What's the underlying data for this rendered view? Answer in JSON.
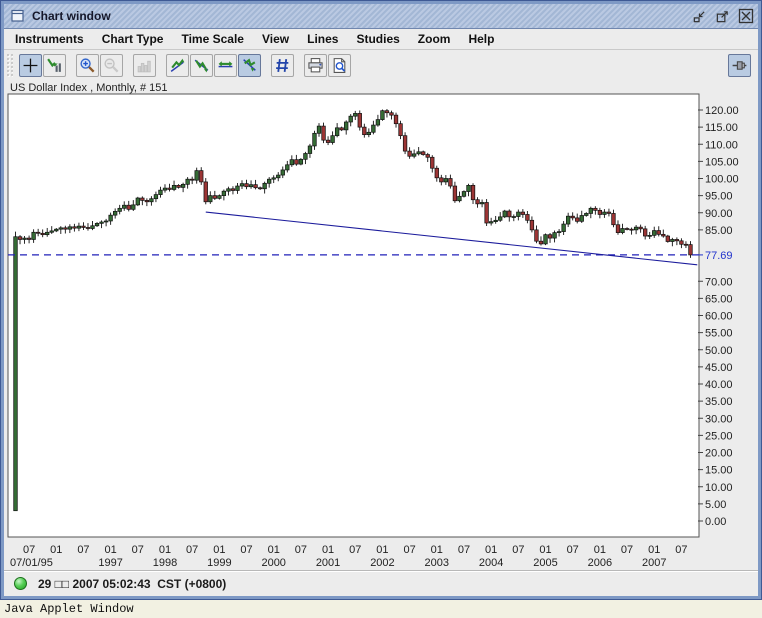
{
  "window": {
    "title": "Chart window",
    "controls": [
      "iconify",
      "maximize",
      "close"
    ]
  },
  "menu": {
    "items": [
      {
        "label": "Instruments"
      },
      {
        "label": "Chart Type"
      },
      {
        "label": "Time Scale"
      },
      {
        "label": "View"
      },
      {
        "label": "Lines"
      },
      {
        "label": "Studies"
      },
      {
        "label": "Zoom"
      },
      {
        "label": "Help"
      }
    ]
  },
  "toolbar": {
    "buttons": [
      {
        "name": "crosshair",
        "state": "selected"
      },
      {
        "name": "candle-data-tool",
        "state": "normal"
      },
      {
        "name": "zoom-in",
        "state": "normal"
      },
      {
        "name": "zoom-out",
        "state": "disabled"
      },
      {
        "name": "histogram",
        "state": "disabled"
      },
      {
        "name": "trendline-up",
        "state": "normal"
      },
      {
        "name": "trendline-down",
        "state": "normal"
      },
      {
        "name": "horizontal-line",
        "state": "normal"
      },
      {
        "name": "erase-line",
        "state": "selected"
      },
      {
        "name": "grid-hash",
        "state": "normal"
      },
      {
        "name": "print",
        "state": "normal"
      },
      {
        "name": "print-preview",
        "state": "normal"
      },
      {
        "name": "pin",
        "state": "selected"
      }
    ]
  },
  "chart_data": {
    "type": "candlestick",
    "title": "US Dollar Index , Monthly, # 151",
    "instrument_label": "US Dollar Index , Monthly, # 151",
    "start_month": "1995-04",
    "interval": "monthly",
    "current_price": 77.69,
    "current_price_label": "77.69",
    "level_line": {
      "price": 77.69,
      "style": "dashed",
      "color": "#2020b8"
    },
    "trendline": {
      "start_month_index": 42,
      "start_price": 90.2,
      "end_month_index": 150.5,
      "end_price": 74.8,
      "color": "#1c1c9c"
    },
    "first_bar": {
      "open": 3.0,
      "high": 84.5,
      "low": 3.0,
      "close": 83.0
    },
    "closes": [
      83.0,
      82.2,
      82.6,
      82.2,
      84.3,
      84.0,
      83.6,
      84.3,
      84.7,
      85.2,
      85.6,
      85.2,
      85.9,
      85.5,
      86.1,
      85.7,
      85.4,
      86.2,
      86.9,
      87.3,
      87.6,
      89.3,
      90.4,
      91.3,
      92.2,
      91.0,
      92.3,
      94.3,
      93.6,
      93.2,
      94.1,
      95.3,
      96.6,
      97.2,
      96.8,
      98.0,
      97.4,
      98.3,
      99.8,
      99.5,
      102.3,
      99.0,
      93.2,
      95.0,
      94.2,
      95.0,
      96.3,
      97.0,
      96.5,
      97.8,
      98.5,
      97.6,
      98.2,
      97.3,
      97.0,
      98.6,
      99.8,
      100.2,
      101.0,
      102.5,
      104.0,
      105.5,
      104.2,
      105.6,
      107.3,
      109.5,
      113.2,
      115.3,
      111.2,
      110.5,
      112.5,
      114.8,
      114.2,
      116.5,
      118.2,
      119.0,
      115.0,
      112.8,
      113.5,
      115.6,
      117.2,
      119.8,
      119.2,
      118.5,
      116.0,
      112.5,
      108.0,
      106.5,
      107.2,
      107.8,
      107.0,
      106.2,
      103.0,
      100.2,
      99.0,
      100.0,
      97.8,
      93.5,
      94.8,
      96.2,
      98.0,
      93.8,
      92.6,
      93.0,
      87.0,
      87.4,
      87.8,
      88.8,
      90.5,
      88.8,
      88.9,
      90.2,
      89.5,
      87.8,
      85.0,
      81.7,
      80.9,
      83.6,
      82.6,
      84.2,
      84.5,
      86.7,
      89.0,
      88.5,
      87.5,
      89.2,
      89.8,
      91.3,
      90.7,
      89.5,
      90.2,
      89.8,
      86.5,
      84.2,
      85.4,
      85.2,
      85.0,
      85.8,
      85.3,
      83.2,
      83.4,
      84.8,
      83.7,
      83.2,
      81.6,
      82.2,
      81.8,
      80.8,
      80.7,
      77.69
    ],
    "y_axis": {
      "min": 0,
      "max": 120,
      "step": 5,
      "ticks": [
        120,
        115,
        110,
        105,
        100,
        95,
        90,
        85,
        70,
        65,
        60,
        55,
        50,
        45,
        40,
        35,
        30,
        25,
        20,
        15,
        10,
        5,
        0
      ],
      "label_format": "0.00"
    },
    "x_axis": {
      "ticks": [
        {
          "m": 3,
          "label": "07",
          "sub": "07/01/95"
        },
        {
          "m": 9,
          "label": "01",
          "sub": ""
        },
        {
          "m": 15,
          "label": "07",
          "sub": ""
        },
        {
          "m": 21,
          "label": "01",
          "sub": "1997"
        },
        {
          "m": 27,
          "label": "07",
          "sub": ""
        },
        {
          "m": 33,
          "label": "01",
          "sub": "1998"
        },
        {
          "m": 39,
          "label": "07",
          "sub": ""
        },
        {
          "m": 45,
          "label": "01",
          "sub": "1999"
        },
        {
          "m": 51,
          "label": "07",
          "sub": ""
        },
        {
          "m": 57,
          "label": "01",
          "sub": "2000"
        },
        {
          "m": 63,
          "label": "07",
          "sub": ""
        },
        {
          "m": 69,
          "label": "01",
          "sub": "2001"
        },
        {
          "m": 75,
          "label": "07",
          "sub": ""
        },
        {
          "m": 81,
          "label": "01",
          "sub": "2002"
        },
        {
          "m": 87,
          "label": "07",
          "sub": ""
        },
        {
          "m": 93,
          "label": "01",
          "sub": "2003"
        },
        {
          "m": 99,
          "label": "07",
          "sub": ""
        },
        {
          "m": 105,
          "label": "01",
          "sub": "2004"
        },
        {
          "m": 111,
          "label": "07",
          "sub": ""
        },
        {
          "m": 117,
          "label": "01",
          "sub": "2005"
        },
        {
          "m": 123,
          "label": "07",
          "sub": ""
        },
        {
          "m": 129,
          "label": "01",
          "sub": "2006"
        },
        {
          "m": 135,
          "label": "07",
          "sub": ""
        },
        {
          "m": 141,
          "label": "01",
          "sub": "2007"
        },
        {
          "m": 147,
          "label": "07",
          "sub": ""
        }
      ]
    },
    "colors": {
      "up": "#356b35",
      "down": "#9c3535",
      "wick": "#101010",
      "axis_text": "#222222",
      "current_price_text": "#2233cc",
      "plot_border": "#555555",
      "plot_bg": "#ffffff"
    }
  },
  "status": {
    "text": "29 □□ 2007 05:02:43  CST (+0800)"
  },
  "banner": {
    "text": "Java Applet Window"
  }
}
